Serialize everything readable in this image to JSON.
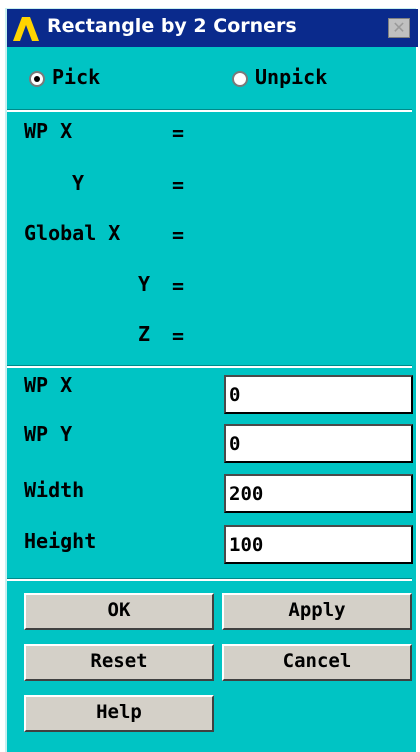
{
  "window": {
    "title": "Rectangle by 2 Corners",
    "close_symbol": "✕"
  },
  "mode": {
    "pick_label": "Pick",
    "unpick_label": "Unpick",
    "selected": "Pick"
  },
  "coords": {
    "wp_x_label": "WP X",
    "wp_y_label": "Y",
    "global_x_label": "Global X",
    "global_y_label": "Y",
    "global_z_label": "Z",
    "equals": "="
  },
  "inputs": {
    "wp_x_label": "WP X",
    "wp_x_value": "0",
    "wp_y_label": "WP Y",
    "wp_y_value": "0",
    "width_label": "Width",
    "width_value": "200",
    "height_label": "Height",
    "height_value": "100"
  },
  "buttons": {
    "ok": "OK",
    "apply": "Apply",
    "reset": "Reset",
    "cancel": "Cancel",
    "help": "Help"
  },
  "colors": {
    "dialog_bg": "#00c4c4",
    "title_bg": "#0a2a8c",
    "logo": "#ffd400"
  }
}
